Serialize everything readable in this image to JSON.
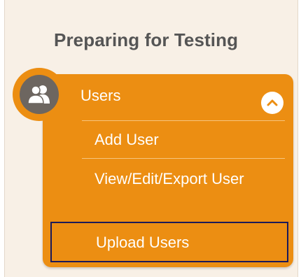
{
  "panel": {
    "title": "Preparing for Testing"
  },
  "menu": {
    "header_label": "Users",
    "header_icon": "users-icon",
    "collapse_icon": "chevron-up-icon",
    "items": [
      {
        "label": "Add User"
      },
      {
        "label": "View/Edit/Export User"
      },
      {
        "label": "Upload Users"
      }
    ]
  },
  "colors": {
    "menu_bg": "#ec8e12",
    "panel_bg": "#f8f0e6",
    "title_text": "#555555",
    "avatar_bg": "#6d6660",
    "highlight_border": "#1b1a5a"
  }
}
